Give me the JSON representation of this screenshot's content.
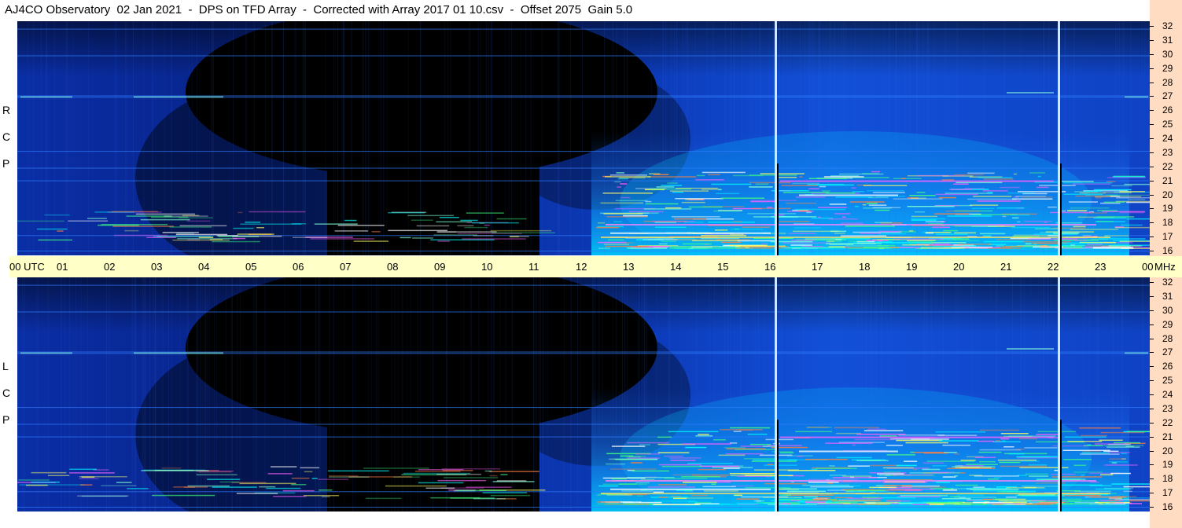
{
  "title": "AJ4CO Observatory  02 Jan 2021  -  DPS on TFD Array  -  Corrected with Array 2017 01 10.csv  -  Offset 2075  Gain 5.0",
  "time_axis": {
    "labels": [
      "00 UTC",
      "01",
      "02",
      "03",
      "04",
      "05",
      "06",
      "07",
      "08",
      "09",
      "10",
      "11",
      "12",
      "13",
      "14",
      "15",
      "16",
      "17",
      "18",
      "19",
      "20",
      "21",
      "22",
      "23",
      "00"
    ],
    "unit": "MHz"
  },
  "panels": [
    {
      "id": "rcp",
      "letters": [
        "R",
        "C",
        "P"
      ]
    },
    {
      "id": "lcp",
      "letters": [
        "L",
        "C",
        "P"
      ]
    }
  ],
  "freq_labels": [
    "32",
    "31",
    "30",
    "29",
    "28",
    "27",
    "26",
    "25",
    "24",
    "23",
    "22",
    "21",
    "20",
    "19",
    "18",
    "17",
    "16"
  ],
  "colors": {
    "background_blue": "#0a2a9a",
    "quiet_night": "#000000",
    "high_intensity": "#00e0ff",
    "strip_right": "#ffdcc2",
    "time_axis_bg": "#ffffc8"
  },
  "chart_data": {
    "type": "heatmap",
    "x": {
      "label": "UTC",
      "ticks": [
        "00",
        "01",
        "02",
        "03",
        "04",
        "05",
        "06",
        "07",
        "08",
        "09",
        "10",
        "11",
        "12",
        "13",
        "14",
        "15",
        "16",
        "17",
        "18",
        "19",
        "20",
        "21",
        "22",
        "23",
        "00"
      ],
      "range_hours": [
        0,
        24
      ]
    },
    "y": {
      "label": "MHz",
      "range": [
        16,
        32
      ],
      "ticks": [
        32,
        31,
        30,
        29,
        28,
        27,
        26,
        25,
        24,
        23,
        22,
        21,
        20,
        19,
        18,
        17,
        16
      ]
    },
    "series": [
      {
        "name": "RCP"
      },
      {
        "name": "LCP"
      }
    ],
    "vertical_markers_utc": [
      16.1,
      22.1
    ]
  }
}
